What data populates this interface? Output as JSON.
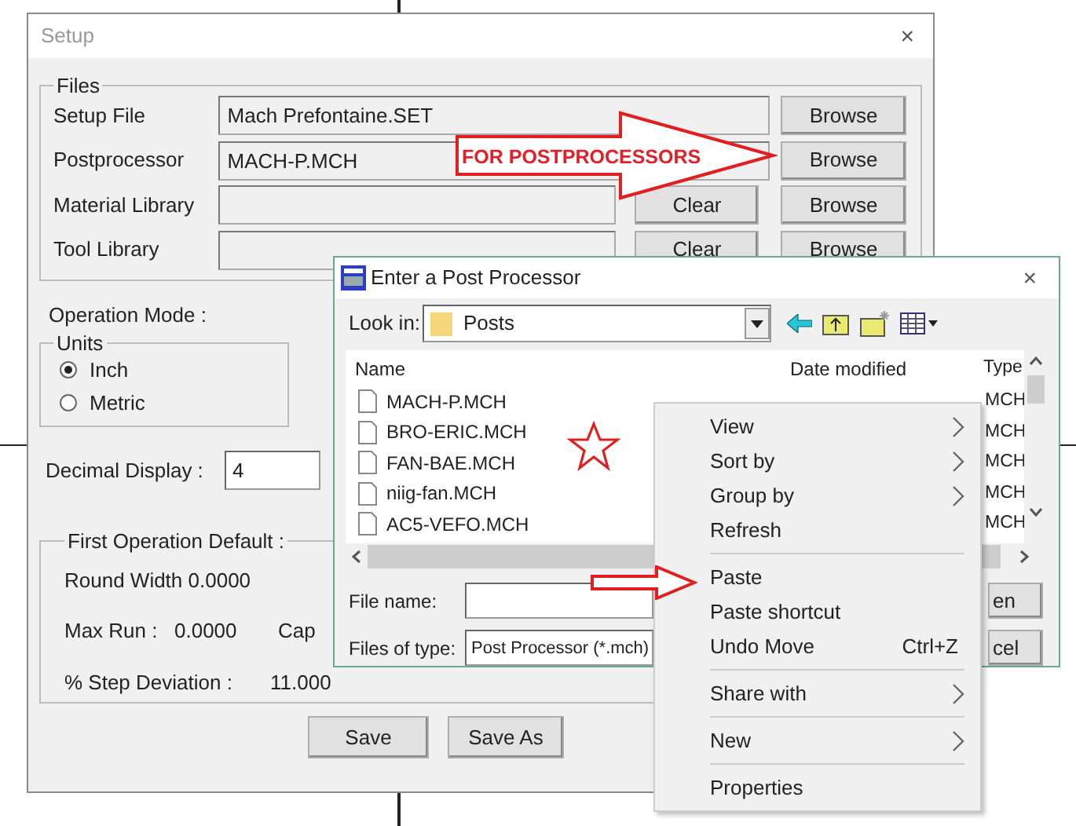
{
  "setup_window": {
    "title": "Setup",
    "close_glyph": "×",
    "files": {
      "legend": "Files",
      "rows": [
        {
          "label": "Setup File",
          "value": "Mach Prefontaine.SET",
          "buttons": [
            "Browse"
          ]
        },
        {
          "label": "Postprocessor",
          "value": "MACH-P.MCH",
          "buttons": [
            "Browse"
          ]
        },
        {
          "label": "Material Library",
          "buttons": [
            "Clear",
            "Browse"
          ]
        },
        {
          "label": "Tool Library",
          "buttons": [
            "Clear",
            "Browse"
          ]
        }
      ]
    },
    "operation_mode_label": "Operation Mode :",
    "units": {
      "legend": "Units",
      "options": [
        {
          "label": "Inch",
          "selected": true
        },
        {
          "label": "Metric",
          "selected": false
        }
      ]
    },
    "decimal_display": {
      "label": "Decimal Display :",
      "value": "4"
    },
    "first_operation_default": {
      "legend": "First Operation Default :",
      "round_width": "Round  Width 0.0000",
      "max_run_label": "Max Run :",
      "max_run_value": "0.0000",
      "cap_label": "Cap",
      "step_deviation_label": "% Step Deviation :",
      "step_deviation_value": "11.000"
    },
    "buttons": [
      "Save",
      "Save As"
    ]
  },
  "annotation": {
    "text": "FOR POSTPROCESSORS"
  },
  "file_dialog": {
    "title": "Enter a Post Processor",
    "close_glyph": "×",
    "look_in_label": "Look in:",
    "look_in_value": "Posts",
    "columns": [
      "Name",
      "Date modified",
      "Type"
    ],
    "files": [
      {
        "name": "MACH-P.MCH",
        "type": "MCH"
      },
      {
        "name": "BRO-ERIC.MCH",
        "type": "MCH"
      },
      {
        "name": "FAN-BAE.MCH",
        "type": "MCH"
      },
      {
        "name": "niig-fan.MCH",
        "type": "MCH"
      },
      {
        "name": "AC5-VEFO.MCH",
        "type": "MCH"
      }
    ],
    "file_name_label": "File name:",
    "files_of_type_label": "Files of type:",
    "files_of_type_value": "Post Processor (*.mch)",
    "buttons": [
      "en",
      "cel"
    ]
  },
  "context_menu": {
    "items": [
      {
        "kind": "item",
        "label": "View",
        "submenu": true
      },
      {
        "kind": "item",
        "label": "Sort by",
        "submenu": true
      },
      {
        "kind": "item",
        "label": "Group by",
        "submenu": true
      },
      {
        "kind": "item",
        "label": "Refresh",
        "submenu": false
      },
      {
        "kind": "separator"
      },
      {
        "kind": "item",
        "label": "Paste",
        "submenu": false
      },
      {
        "kind": "item",
        "label": "Paste shortcut",
        "submenu": false
      },
      {
        "kind": "item",
        "label": "Undo Move",
        "shortcut": "Ctrl+Z",
        "submenu": false
      },
      {
        "kind": "separator"
      },
      {
        "kind": "item",
        "label": "Share with",
        "submenu": true
      },
      {
        "kind": "separator"
      },
      {
        "kind": "item",
        "label": "New",
        "submenu": true
      },
      {
        "kind": "separator"
      },
      {
        "kind": "item",
        "label": "Properties",
        "submenu": false
      }
    ]
  }
}
